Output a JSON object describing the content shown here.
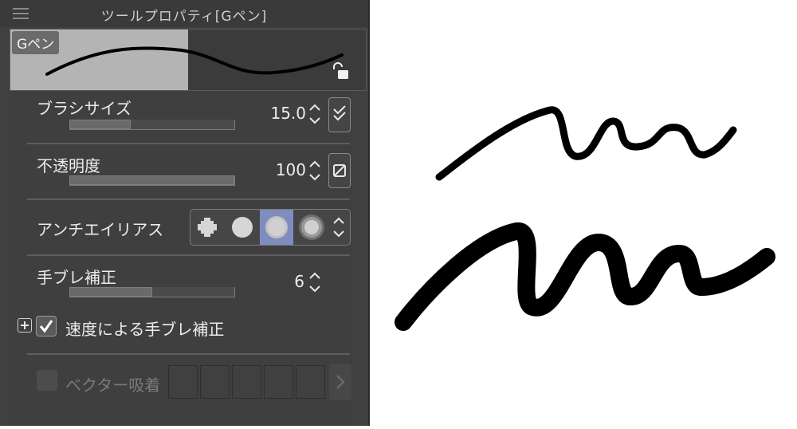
{
  "panel": {
    "title": "ツールプロパティ[Gペン]",
    "preview_label": "Gペン"
  },
  "props": {
    "brush_size": {
      "label": "ブラシサイズ",
      "value": "15.0",
      "slider_fraction": 0.37
    },
    "opacity": {
      "label": "不透明度",
      "value": "100",
      "slider_fraction": 1.0
    },
    "antialias": {
      "label": "アンチエイリアス",
      "options": [
        "none-icon",
        "weak-icon",
        "medium-icon",
        "strong-icon"
      ],
      "selected_index": 2
    },
    "stabilization": {
      "label": "手ブレ補正",
      "value": "6",
      "slider_fraction": 0.5
    },
    "speed_stabilization": {
      "label": "速度による手ブレ補正",
      "checked": true
    },
    "vector_snap": {
      "label": "ベクター吸着",
      "enabled": false
    }
  },
  "colors": {
    "panel_bg": "#404040",
    "selected": "#7f8dbe",
    "text": "#ececec"
  }
}
